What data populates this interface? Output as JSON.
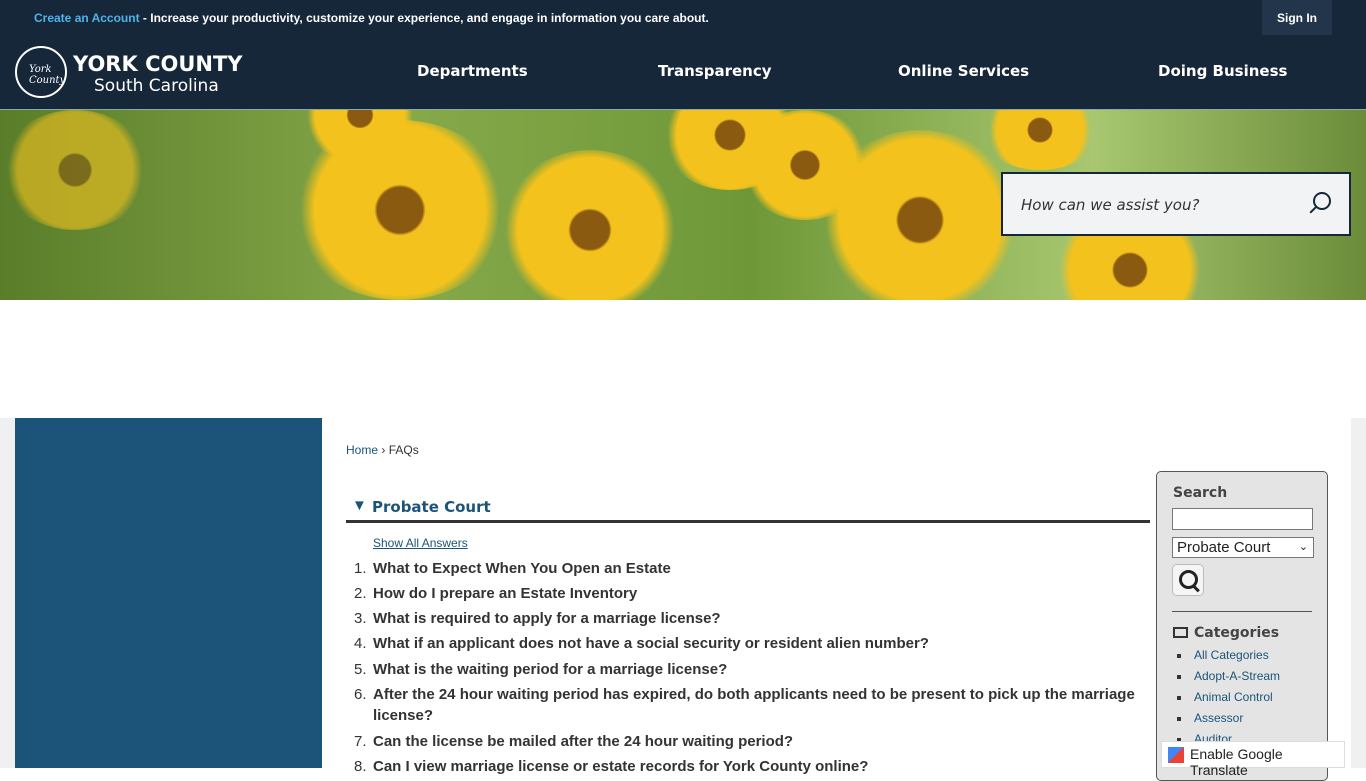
{
  "topbar": {
    "create_account": "Create an Account",
    "message": " - Increase your productivity, customize your experience, and engage in information you care about.",
    "sign_in": "Sign In"
  },
  "logo": {
    "title": "YORK COUNTY",
    "subtitle": "South Carolina",
    "seal_text": "York County"
  },
  "nav": [
    "Departments",
    "Transparency",
    "Online Services",
    "Doing Business"
  ],
  "hero": {
    "search_placeholder": "How can we assist you?"
  },
  "breadcrumb": {
    "home": "Home",
    "sep": "›",
    "current": "FAQs"
  },
  "category": {
    "title": "Probate Court",
    "show_all": "Show All Answers"
  },
  "faqs": [
    {
      "n": "1.",
      "q": "What to Expect When You Open an Estate"
    },
    {
      "n": "2.",
      "q": "How do I prepare an Estate Inventory"
    },
    {
      "n": "3.",
      "q": "What is required to apply for a marriage license?"
    },
    {
      "n": "4.",
      "q": "What if an applicant does not have a social security or resident alien number?"
    },
    {
      "n": "5.",
      "q": "What is the waiting period for a marriage license?"
    },
    {
      "n": "6.",
      "q": "After the 24 hour waiting period has expired, do both applicants need to be present to pick up the marriage license?"
    },
    {
      "n": "7.",
      "q": "Can the license be mailed after the 24 hour waiting period?"
    },
    {
      "n": "8.",
      "q": "Can I view marriage license or estate records for York County online?"
    }
  ],
  "sidebar": {
    "search_heading": "Search",
    "search_value": "",
    "category_select": "Probate Court",
    "categories_heading": "Categories",
    "categories": [
      "All Categories",
      "Adopt-A-Stream",
      "Animal Control",
      "Assessor",
      "Auditor"
    ]
  },
  "translate": "Enable Google Translate"
}
